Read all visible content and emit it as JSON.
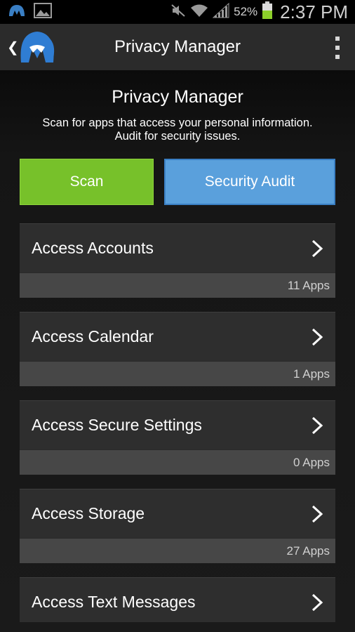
{
  "status_bar": {
    "battery_percent": "52%",
    "time": "2:37 PM"
  },
  "action_bar": {
    "title": "Privacy Manager"
  },
  "main": {
    "heading": "Privacy Manager",
    "subtitle_line1": "Scan for apps that access your personal information.",
    "subtitle_line2": "Audit for security issues.",
    "scan_label": "Scan",
    "audit_label": "Security Audit",
    "categories": [
      {
        "label": "Access Accounts",
        "count": "11 Apps"
      },
      {
        "label": "Access Calendar",
        "count": "1 Apps"
      },
      {
        "label": "Access Secure Settings",
        "count": "0 Apps"
      },
      {
        "label": "Access Storage",
        "count": "27 Apps"
      },
      {
        "label": "Access Text Messages",
        "count": ""
      }
    ]
  },
  "colors": {
    "scan_green": "#77c12a",
    "audit_blue": "#5aa0dc",
    "battery_green": "#8ccf2a"
  }
}
